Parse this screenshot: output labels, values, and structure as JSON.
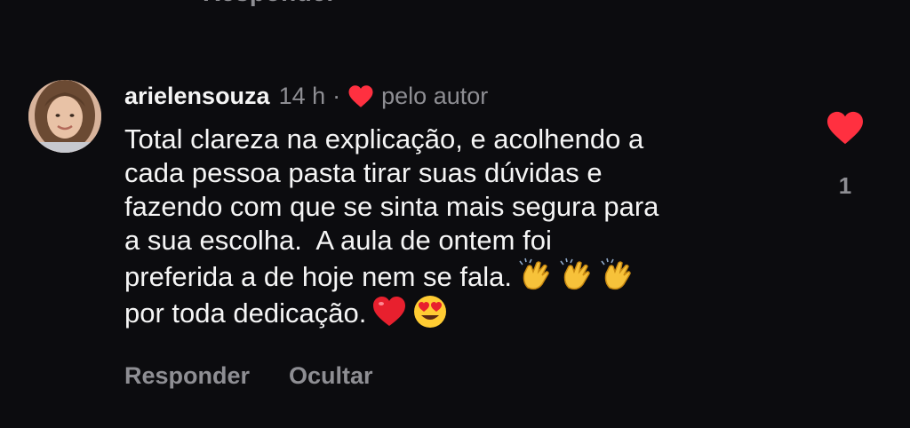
{
  "previous_comment": {
    "reply_label": "Responder"
  },
  "comment": {
    "username": "arielensouza",
    "time": "14 h",
    "separator": "·",
    "liked_by_author_label": "pelo autor",
    "text_lines": [
      "Total clareza na explicação, e acolhendo a",
      "cada pessoa pasta tirar suas dúvidas e",
      "fazendo com que se sinta mais segura para",
      "a sua escolha.  A aula de ontem foi",
      "preferida a de hoje nem se fala.",
      "por toda dedicação."
    ],
    "emojis": {
      "line5": [
        "clapping-hands",
        "clapping-hands",
        "clapping-hands"
      ],
      "line6": [
        "red-heart",
        "heart-eyes-face"
      ]
    },
    "like_count": "1",
    "actions": {
      "reply_label": "Responder",
      "hide_label": "Ocultar"
    }
  },
  "colors": {
    "background": "#0c0c0f",
    "text": "#f5f5f5",
    "muted": "#8e8e93",
    "heart": "#ff3040"
  }
}
